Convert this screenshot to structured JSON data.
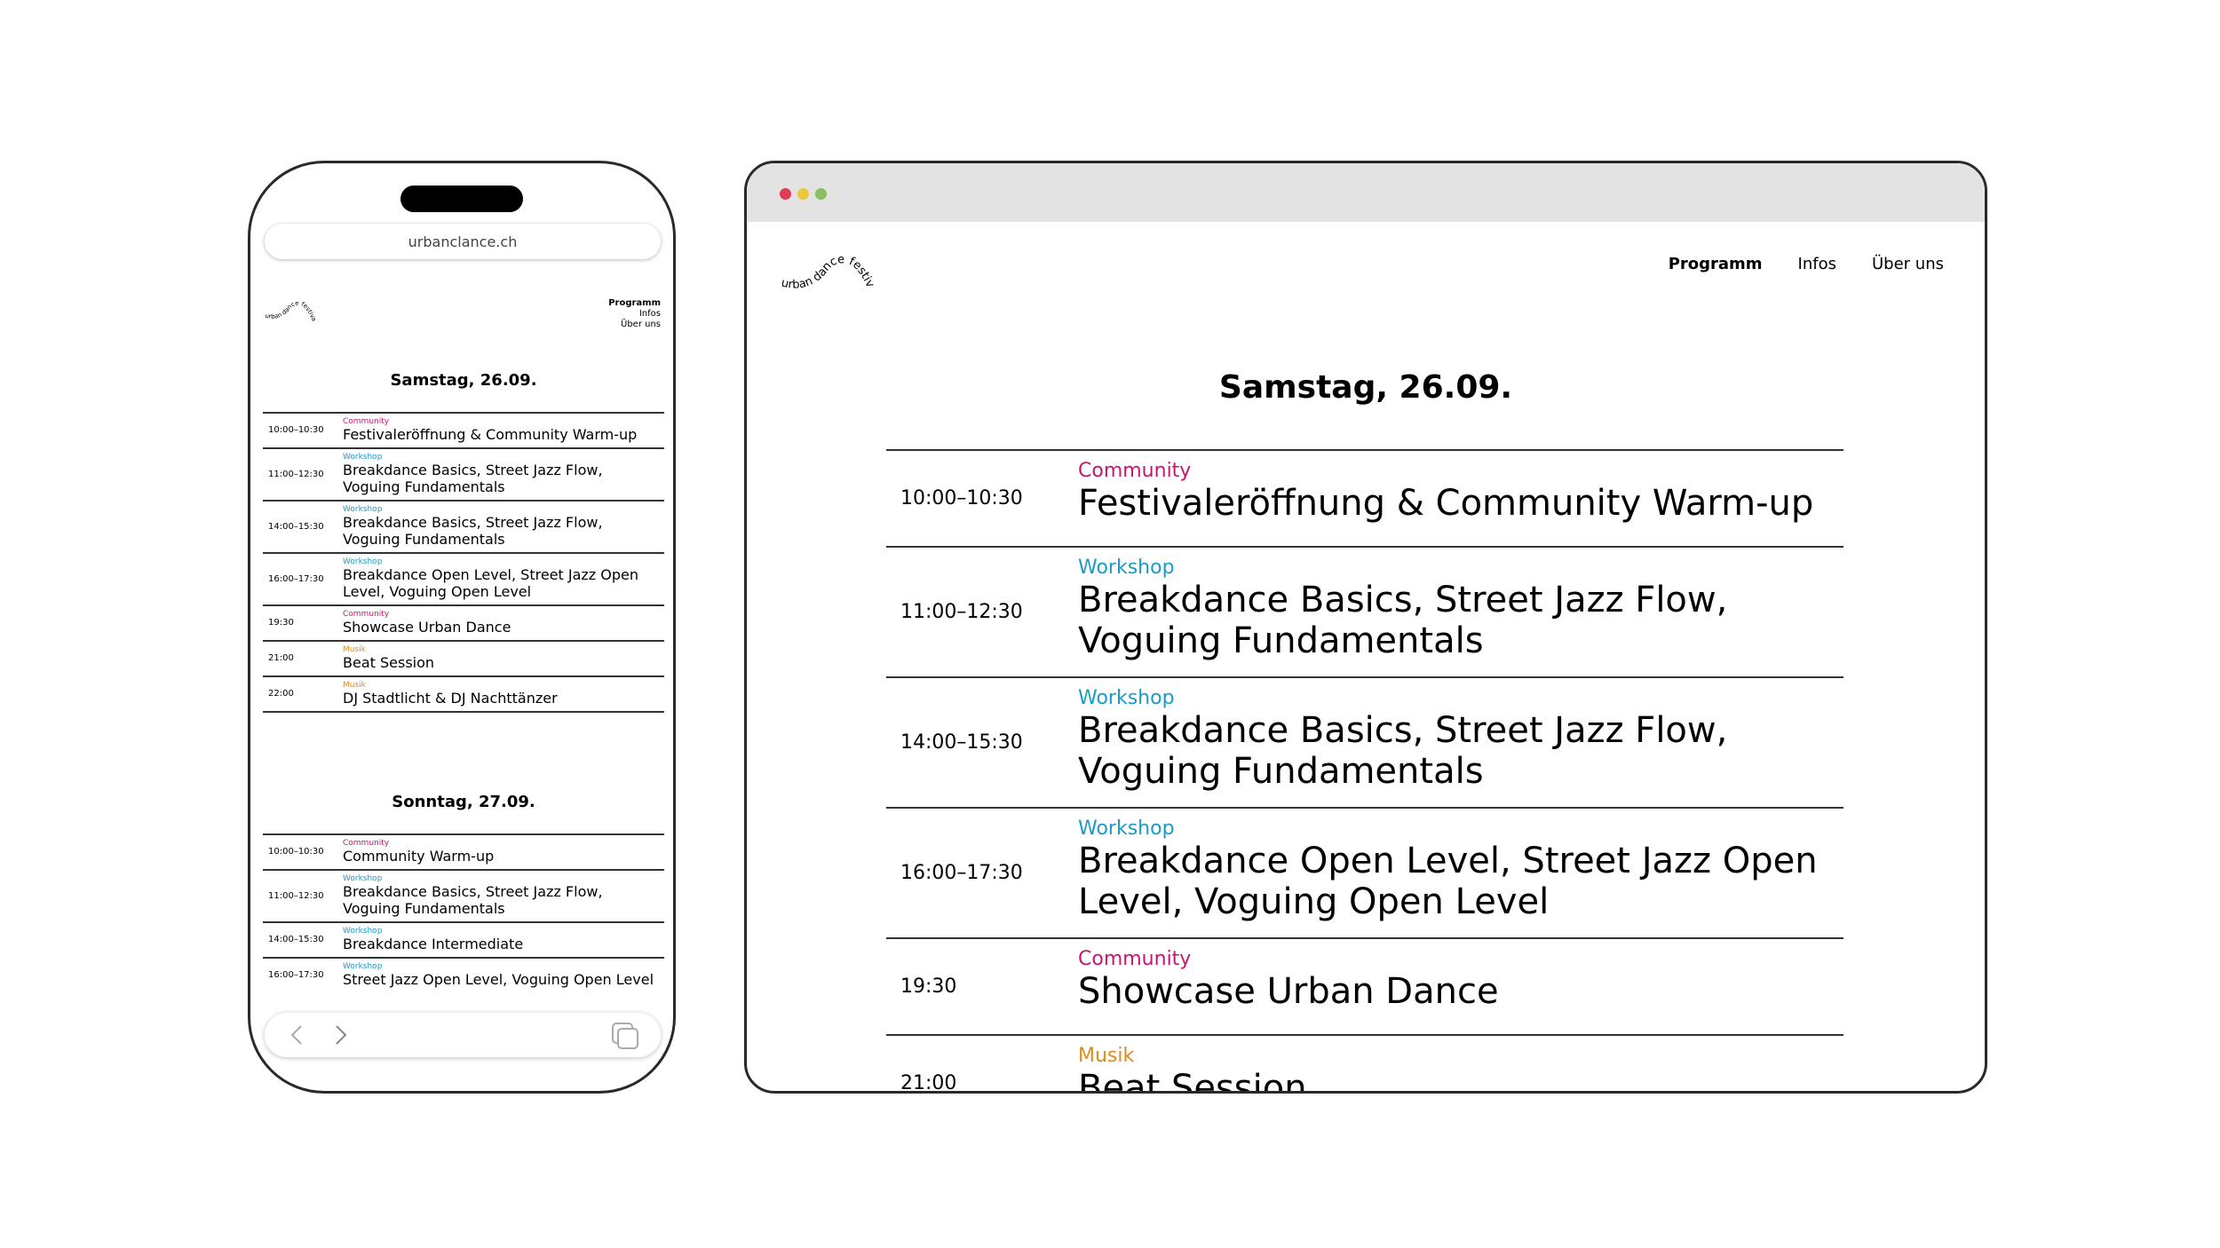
{
  "colors": {
    "community": "#c7166f",
    "workshop": "#1b9bc7",
    "musik": "#e08a1e",
    "dot_red": "#e03b54",
    "dot_yellow": "#e8c93a",
    "dot_green": "#8bbf5e"
  },
  "logo": {
    "word1": "urban",
    "word2": "dance",
    "word3": "festival"
  },
  "nav": [
    "Programm",
    "Infos",
    "Über uns"
  ],
  "phone": {
    "url": "urbanclance.ch",
    "days": [
      {
        "title": "Samstag, 26.09.",
        "events": [
          {
            "time": "10:00–10:30",
            "category": "Community",
            "color": "#c7166f",
            "title": "Festivaleröffnung & Community Warm-up"
          },
          {
            "time": "11:00–12:30",
            "category": "Workshop",
            "color": "#1b9bc7",
            "title": "Breakdance Basics, Street Jazz Flow, Voguing Fundamentals"
          },
          {
            "time": "14:00–15:30",
            "category": "Workshop",
            "color": "#1b9bc7",
            "title": "Breakdance Basics, Street Jazz Flow, Voguing Fundamentals"
          },
          {
            "time": "16:00–17:30",
            "category": "Workshop",
            "color": "#1b9bc7",
            "title": "Breakdance Open Level, Street Jazz Open Level, Voguing Open Level"
          },
          {
            "time": "19:30",
            "category": "Community",
            "color": "#c7166f",
            "title": "Showcase Urban Dance"
          },
          {
            "time": "21:00",
            "category": "Musik",
            "color": "#e08a1e",
            "title": "Beat Session"
          },
          {
            "time": "22:00",
            "category": "Musik",
            "color": "#e08a1e",
            "title": "DJ Stadtlicht & DJ Nachttänzer"
          }
        ]
      },
      {
        "title": "Sonntag, 27.09.",
        "events": [
          {
            "time": "10:00–10:30",
            "category": "Community",
            "color": "#c7166f",
            "title": "Community Warm-up"
          },
          {
            "time": "11:00–12:30",
            "category": "Workshop",
            "color": "#1b9bc7",
            "title": "Breakdance Basics, Street Jazz Flow, Voguing Fundamentals"
          },
          {
            "time": "14:00–15:30",
            "category": "Workshop",
            "color": "#1b9bc7",
            "title": "Breakdance Intermediate"
          },
          {
            "time": "16:00–17:30",
            "category": "Workshop",
            "color": "#1b9bc7",
            "title": "Street Jazz Open Level, Voguing Open Level"
          }
        ]
      }
    ]
  },
  "desktop": {
    "day_title": "Samstag, 26.09.",
    "events": [
      {
        "time": "10:00–10:30",
        "category": "Community",
        "color": "#c7166f",
        "title": "Festivaleröffnung & Community Warm-up"
      },
      {
        "time": "11:00–12:30",
        "category": "Workshop",
        "color": "#1b9bc7",
        "title": "Breakdance Basics, Street Jazz Flow, Voguing Fundamentals"
      },
      {
        "time": "14:00–15:30",
        "category": "Workshop",
        "color": "#1b9bc7",
        "title": "Breakdance Basics, Street Jazz Flow, Voguing Fundamentals"
      },
      {
        "time": "16:00–17:30",
        "category": "Workshop",
        "color": "#1b9bc7",
        "title": "Breakdance Open Level, Street Jazz Open Level, Voguing Open Level"
      },
      {
        "time": "19:30",
        "category": "Community",
        "color": "#c7166f",
        "title": "Showcase Urban Dance"
      },
      {
        "time": "21:00",
        "category": "Musik",
        "color": "#e08a1e",
        "title": "Beat Session"
      }
    ]
  }
}
